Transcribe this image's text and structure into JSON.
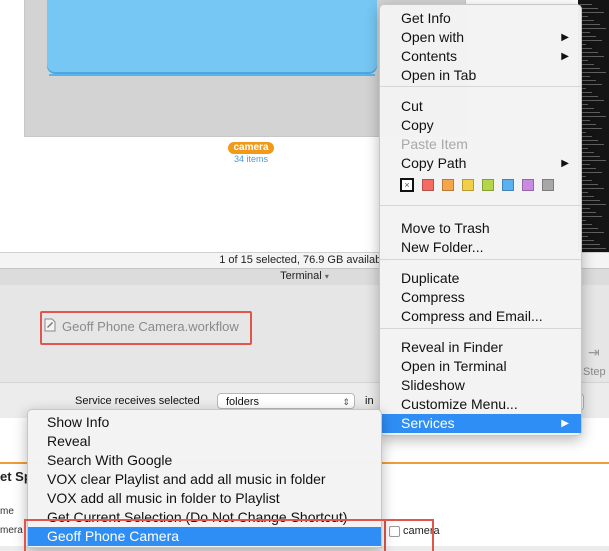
{
  "finder": {
    "folder_badge": "camera",
    "folder_count": "34 items",
    "status": "1 of 15 selected, 76.9 GB available",
    "tab_label": "Terminal"
  },
  "automator": {
    "workflow_name": "Geoff Phone Camera.workflow",
    "step_label": "Step",
    "service_label": "Service receives selected",
    "service_value": "folders",
    "in_label": "in",
    "section_title": "et Sp",
    "row1": "me",
    "row2": "mera",
    "camera_cell": "camera"
  },
  "context_menu": {
    "groups": [
      [
        {
          "label": "Get Info",
          "submenu": false
        },
        {
          "label": "Open with",
          "submenu": true
        },
        {
          "label": "Contents",
          "submenu": true
        },
        {
          "label": "Open in Tab",
          "submenu": false
        }
      ],
      [
        {
          "label": "Cut",
          "submenu": false
        },
        {
          "label": "Copy",
          "submenu": false
        },
        {
          "label": "Paste Item",
          "submenu": false,
          "disabled": true
        },
        {
          "label": "Copy Path",
          "submenu": true
        }
      ],
      [
        {
          "label": "Move to Trash",
          "submenu": false
        },
        {
          "label": "New Folder...",
          "submenu": false
        }
      ],
      [
        {
          "label": "Duplicate",
          "submenu": false
        },
        {
          "label": "Compress",
          "submenu": false
        },
        {
          "label": "Compress and Email...",
          "submenu": false
        }
      ],
      [
        {
          "label": "Reveal in Finder",
          "submenu": false
        },
        {
          "label": "Open in Terminal",
          "submenu": false
        },
        {
          "label": "Slideshow",
          "submenu": false
        },
        {
          "label": "Customize Menu...",
          "submenu": false
        },
        {
          "label": "Services",
          "submenu": true,
          "highlighted": true
        }
      ]
    ],
    "tag_colors": [
      "#f36b63",
      "#f5a64a",
      "#f3cf48",
      "#b3d548",
      "#5ab1f2",
      "#c98be0",
      "#a7a7a7"
    ],
    "submenu_arrow": "▶"
  },
  "services_menu": {
    "items": [
      "Show Info",
      "Reveal",
      "Search With Google",
      "VOX clear Playlist and add all music in folder",
      "VOX add all music in folder to Playlist",
      "Get Current Selection (Do Not Change Shortcut)",
      "Geoff Phone Camera"
    ],
    "highlighted_index": 6
  }
}
